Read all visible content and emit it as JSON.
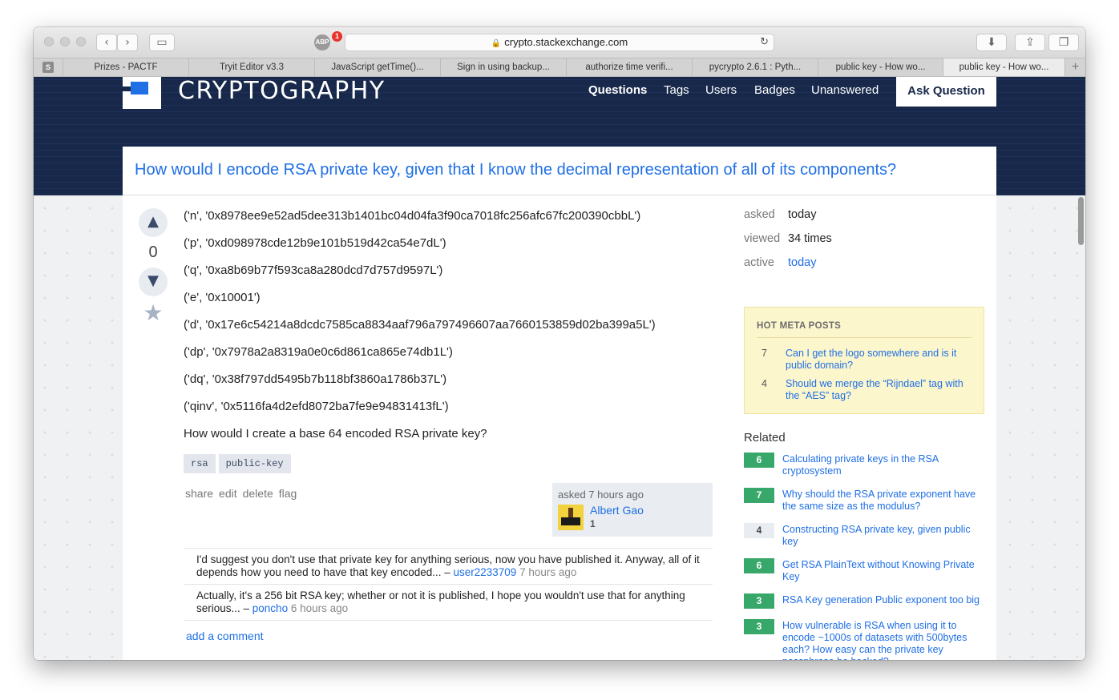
{
  "browser": {
    "url": "crypto.stackexchange.com",
    "adblock_badge": "1",
    "adblock_label": "ABP",
    "pinned_tab": "S",
    "tabs": [
      {
        "label": "Prizes - PACTF"
      },
      {
        "label": "Tryit Editor v3.3"
      },
      {
        "label": "JavaScript getTime()..."
      },
      {
        "label": "Sign in using backup..."
      },
      {
        "label": "authorize time verifi..."
      },
      {
        "label": "pycrypto 2.6.1 : Pyth..."
      },
      {
        "label": "public key - How wo..."
      },
      {
        "label": "public key - How wo..."
      }
    ]
  },
  "site": {
    "logo_text": "CRYPTOGRAPHY",
    "nav": {
      "questions": "Questions",
      "tags": "Tags",
      "users": "Users",
      "badges": "Badges",
      "unanswered": "Unanswered",
      "ask": "Ask Question"
    }
  },
  "question": {
    "title": "How would I encode RSA private key, given that I know the decimal representation of all of its components?",
    "votes": "0",
    "body_lines": [
      "('n', '0x8978ee9e52ad5dee313b1401bc04d04fa3f90ca7018fc256afc67fc200390cbbL')",
      "('p', '0xd098978cde12b9e101b519d42ca54e7dL')",
      "('q', '0xa8b69b77f593ca8a280dcd7d757d9597L')",
      "('e', '0x10001')",
      "('d', '0x17e6c54214a8dcdc7585ca8834aaf796a797496607aa7660153859d02ba399a5L')",
      "('dp', '0x7978a2a8319a0e0c6d861ca865e74db1L')",
      "('dq', '0x38f797dd5495b7b118bf3860a1786b37L')",
      "('qinv', '0x5116fa4d2efd8072ba7fe9e94831413fL')",
      "How would I create a base 64 encoded RSA private key?"
    ],
    "tags": [
      "rsa",
      "public-key"
    ],
    "actions": {
      "share": "share",
      "edit": "edit",
      "delete": "delete",
      "flag": "flag"
    },
    "owner": {
      "asked": "asked 7 hours ago",
      "name": "Albert Gao",
      "rep": "1"
    },
    "comments": [
      {
        "text": "I'd suggest you don't use that private key for anything serious, now you have published it. Anyway, all of it depends how you need to have that key encoded... – ",
        "user": "user2233709",
        "time": " 7 hours ago"
      },
      {
        "text": "Actually, it's a 256 bit RSA key; whether or not it is published, I hope you wouldn't use that for anything serious... – ",
        "user": "poncho",
        "time": " 6 hours ago"
      }
    ],
    "add_comment": "add a comment"
  },
  "sidebar": {
    "asked_label": "asked",
    "asked_value": "today",
    "viewed_label": "viewed",
    "viewed_value": "34 times",
    "active_label": "active",
    "active_value": "today",
    "hot_meta": {
      "title": "HOT META POSTS",
      "items": [
        {
          "count": "7",
          "title": "Can I get the logo somewhere and is it public domain?"
        },
        {
          "count": "4",
          "title": "Should we merge the “Rijndael” tag with the “AES” tag?"
        }
      ]
    },
    "related_title": "Related",
    "related": [
      {
        "score": "6",
        "title": "Calculating private keys in the RSA cryptosystem"
      },
      {
        "score": "7",
        "title": "Why should the RSA private exponent have the same size as the modulus?"
      },
      {
        "score": "4",
        "title": "Constructing RSA private key, given public key"
      },
      {
        "score": "6",
        "title": "Get RSA PlainText without Knowing Private Key"
      },
      {
        "score": "3",
        "title": "RSA Key generation Public exponent too big"
      },
      {
        "score": "3",
        "title": "How vulnerable is RSA when using it to encode ~1000s of datasets with 500bytes each? How easy can the private key passphrase be hacked?"
      }
    ]
  },
  "colors": {
    "header_bg": "#17284a",
    "link": "#1f6fe5",
    "accepted_green": "#38a86a",
    "hot_meta_bg": "#fcf6cd"
  }
}
